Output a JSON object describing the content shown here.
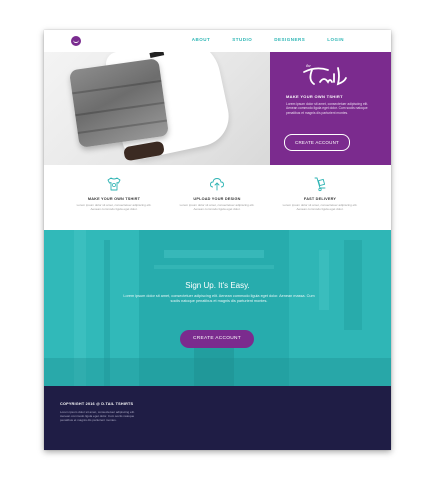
{
  "nav": {
    "links": [
      "ABOUT",
      "STUDIO",
      "DESIGNERS",
      "LOGIN"
    ]
  },
  "hero": {
    "brand": "the Tail",
    "panel_title": "MAKE YOUR OWN TSHIRT",
    "panel_text": "Lorem ipsum dolor sit amet, consectetuer adipiscing elit. Aenean commodo ligula eget dolor. Cum sociis natoque penatibus et magnis dis parturient montes.",
    "button_label": "CREATE ACCOUNT"
  },
  "features": [
    {
      "icon": "tshirt-icon",
      "title": "MAKE YOUR OWN TSHIRT",
      "text": "Lorem ipsum dolor sit amet, consectetuer adipiscing elit. Aenean commodo ligula eget dolor."
    },
    {
      "icon": "upload-cloud-icon",
      "title": "UPLOAD YOUR DESIGN",
      "text": "Lorem ipsum dolor sit amet, consectetuer adipiscing elit. Aenean commodo ligula eget dolor."
    },
    {
      "icon": "delivery-icon",
      "title": "FAST DELIVERY",
      "text": "Lorem ipsum dolor sit amet, consectetuer adipiscing elit. Aenean commodo ligula eget dolor."
    }
  ],
  "signup": {
    "title": "Sign Up. It's Easy.",
    "text": "Lorem ipsum dolor sit amet, consectetuer adipiscing elit. Aenean commodo ligula eget dolor. Aenean massa. Cum sociis natoque penatibus et magnis dis parturient montes.",
    "button_label": "CREATE ACCOUNT"
  },
  "footer": {
    "copyright": "COPYRIGHT 2016 @ D.TAIL TSHIRTS",
    "text": "Lorem ipsum dolor sit amet, consectetuer adipiscing elit. Aenean commodo ligula eget dolor. Cum sociis natoque penatibus et magnis dis parturient montes."
  },
  "colors": {
    "purple": "#7b2b8e",
    "teal": "#2cb3b3",
    "navy": "#1f1d45"
  }
}
